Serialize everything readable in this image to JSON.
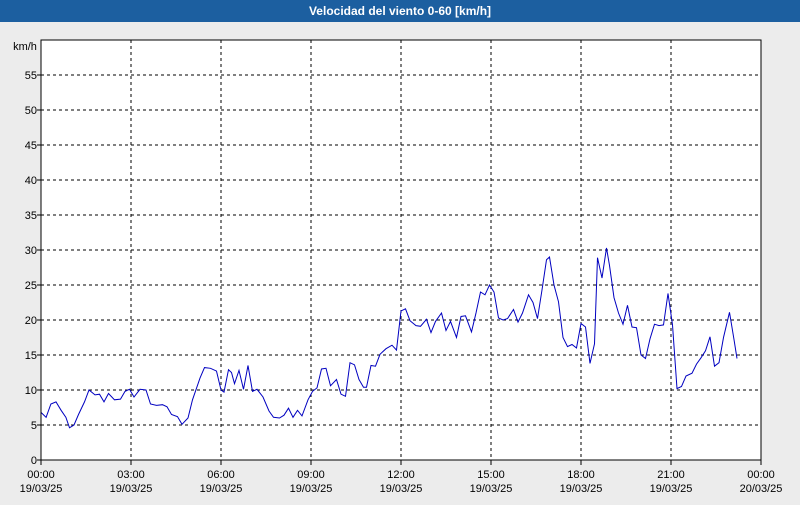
{
  "title": "Velocidad del viento 0-60 [km/h]",
  "chart_data": {
    "type": "line",
    "title": "Velocidad del viento 0-60 [km/h]",
    "ylabel": "km/h",
    "ylim": [
      0,
      60
    ],
    "yticks": [
      0,
      5,
      10,
      15,
      20,
      25,
      30,
      35,
      40,
      45,
      50,
      55
    ],
    "xlim_hours": [
      0,
      24
    ],
    "xticks": [
      {
        "time": "00:00",
        "date": "19/03/25"
      },
      {
        "time": "03:00",
        "date": "19/03/25"
      },
      {
        "time": "06:00",
        "date": "19/03/25"
      },
      {
        "time": "09:00",
        "date": "19/03/25"
      },
      {
        "time": "12:00",
        "date": "19/03/25"
      },
      {
        "time": "15:00",
        "date": "19/03/25"
      },
      {
        "time": "18:00",
        "date": "19/03/25"
      },
      {
        "time": "21:00",
        "date": "19/03/25"
      },
      {
        "time": "00:00",
        "date": "20/03/25"
      }
    ],
    "grid": true,
    "line_color": "#0000c0",
    "series": [
      {
        "points": [
          [
            0.0,
            6.8
          ],
          [
            0.17,
            6.1
          ],
          [
            0.33,
            8.0
          ],
          [
            0.5,
            8.3
          ],
          [
            0.67,
            7.1
          ],
          [
            0.83,
            6.1
          ],
          [
            0.95,
            4.6
          ],
          [
            1.1,
            5.0
          ],
          [
            1.25,
            6.5
          ],
          [
            1.45,
            8.3
          ],
          [
            1.6,
            10.0
          ],
          [
            1.8,
            9.3
          ],
          [
            1.95,
            9.4
          ],
          [
            2.1,
            8.3
          ],
          [
            2.25,
            9.5
          ],
          [
            2.45,
            8.6
          ],
          [
            2.65,
            8.7
          ],
          [
            2.8,
            9.8
          ],
          [
            2.95,
            10.1
          ],
          [
            3.1,
            9.0
          ],
          [
            3.3,
            10.1
          ],
          [
            3.5,
            10.0
          ],
          [
            3.65,
            8.0
          ],
          [
            3.85,
            7.8
          ],
          [
            4.05,
            7.9
          ],
          [
            4.2,
            7.6
          ],
          [
            4.35,
            6.5
          ],
          [
            4.55,
            6.2
          ],
          [
            4.7,
            5.1
          ],
          [
            4.9,
            6.0
          ],
          [
            5.05,
            8.6
          ],
          [
            5.3,
            11.7
          ],
          [
            5.45,
            13.2
          ],
          [
            5.65,
            13.1
          ],
          [
            5.85,
            12.7
          ],
          [
            6.0,
            10.0
          ],
          [
            6.1,
            9.7
          ],
          [
            6.25,
            12.9
          ],
          [
            6.35,
            12.5
          ],
          [
            6.45,
            10.9
          ],
          [
            6.6,
            12.8
          ],
          [
            6.75,
            10.1
          ],
          [
            6.9,
            13.5
          ],
          [
            7.05,
            9.8
          ],
          [
            7.2,
            10.1
          ],
          [
            7.4,
            9.0
          ],
          [
            7.6,
            7.0
          ],
          [
            7.75,
            6.1
          ],
          [
            7.95,
            6.0
          ],
          [
            8.1,
            6.4
          ],
          [
            8.25,
            7.4
          ],
          [
            8.4,
            6.1
          ],
          [
            8.55,
            7.1
          ],
          [
            8.7,
            6.3
          ],
          [
            8.9,
            8.6
          ],
          [
            9.05,
            9.8
          ],
          [
            9.2,
            10.3
          ],
          [
            9.35,
            13.0
          ],
          [
            9.5,
            13.1
          ],
          [
            9.65,
            10.6
          ],
          [
            9.85,
            11.5
          ],
          [
            10.0,
            9.4
          ],
          [
            10.15,
            9.1
          ],
          [
            10.3,
            13.9
          ],
          [
            10.45,
            13.6
          ],
          [
            10.6,
            11.5
          ],
          [
            10.75,
            10.4
          ],
          [
            10.85,
            10.4
          ],
          [
            11.0,
            13.5
          ],
          [
            11.15,
            13.4
          ],
          [
            11.3,
            15.1
          ],
          [
            11.5,
            15.9
          ],
          [
            11.7,
            16.4
          ],
          [
            11.85,
            15.7
          ],
          [
            12.0,
            21.3
          ],
          [
            12.15,
            21.6
          ],
          [
            12.3,
            19.9
          ],
          [
            12.5,
            19.2
          ],
          [
            12.65,
            19.1
          ],
          [
            12.85,
            20.1
          ],
          [
            13.0,
            18.2
          ],
          [
            13.15,
            19.8
          ],
          [
            13.35,
            21.0
          ],
          [
            13.5,
            18.5
          ],
          [
            13.65,
            19.8
          ],
          [
            13.85,
            17.5
          ],
          [
            14.0,
            20.5
          ],
          [
            14.15,
            20.6
          ],
          [
            14.35,
            18.3
          ],
          [
            14.5,
            21.0
          ],
          [
            14.65,
            24.0
          ],
          [
            14.8,
            23.6
          ],
          [
            14.95,
            25.0
          ],
          [
            15.1,
            24.0
          ],
          [
            15.25,
            20.3
          ],
          [
            15.4,
            20.0
          ],
          [
            15.55,
            20.2
          ],
          [
            15.75,
            21.5
          ],
          [
            15.9,
            19.7
          ],
          [
            16.05,
            21.0
          ],
          [
            16.25,
            23.6
          ],
          [
            16.4,
            22.5
          ],
          [
            16.55,
            20.2
          ],
          [
            16.7,
            24.3
          ],
          [
            16.85,
            28.6
          ],
          [
            16.95,
            29.0
          ],
          [
            17.1,
            25.0
          ],
          [
            17.25,
            22.6
          ],
          [
            17.4,
            17.5
          ],
          [
            17.55,
            16.2
          ],
          [
            17.7,
            16.5
          ],
          [
            17.85,
            16.0
          ],
          [
            18.0,
            19.5
          ],
          [
            18.15,
            19.0
          ],
          [
            18.3,
            13.8
          ],
          [
            18.45,
            16.6
          ],
          [
            18.55,
            28.9
          ],
          [
            18.7,
            26.0
          ],
          [
            18.85,
            30.3
          ],
          [
            18.95,
            27.8
          ],
          [
            19.1,
            23.2
          ],
          [
            19.25,
            21.0
          ],
          [
            19.4,
            19.4
          ],
          [
            19.55,
            22.1
          ],
          [
            19.7,
            19.0
          ],
          [
            19.85,
            18.9
          ],
          [
            20.0,
            15.0
          ],
          [
            20.15,
            14.5
          ],
          [
            20.3,
            17.3
          ],
          [
            20.45,
            19.4
          ],
          [
            20.6,
            19.2
          ],
          [
            20.75,
            19.3
          ],
          [
            20.9,
            23.8
          ],
          [
            21.05,
            19.3
          ],
          [
            21.2,
            10.2
          ],
          [
            21.35,
            10.5
          ],
          [
            21.5,
            12.0
          ],
          [
            21.7,
            12.4
          ],
          [
            21.85,
            13.7
          ],
          [
            22.0,
            14.6
          ],
          [
            22.15,
            15.6
          ],
          [
            22.3,
            17.6
          ],
          [
            22.45,
            13.4
          ],
          [
            22.6,
            13.9
          ],
          [
            22.75,
            17.5
          ],
          [
            22.95,
            21.1
          ],
          [
            23.1,
            17.2
          ],
          [
            23.2,
            14.5
          ]
        ]
      }
    ]
  }
}
